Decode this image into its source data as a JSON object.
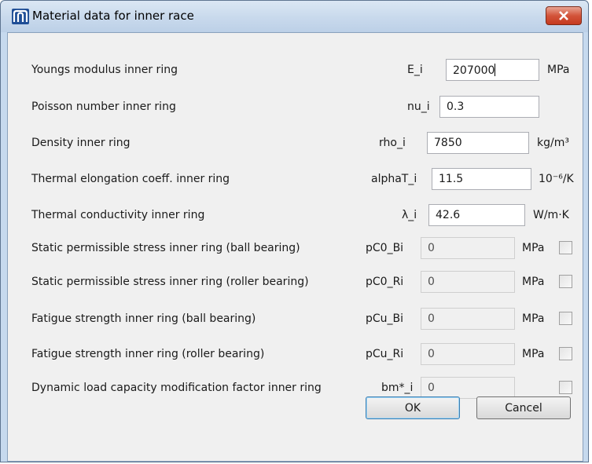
{
  "window": {
    "title": "Material data for inner race",
    "icon": "m-logo-icon"
  },
  "rows": [
    {
      "label": "Youngs modulus inner ring",
      "symbol": "E_i",
      "value": "207000",
      "unit": "MPa"
    },
    {
      "label": "Poisson number inner ring",
      "symbol": "nu_i",
      "value": "0.3",
      "unit": ""
    },
    {
      "label": "Density inner ring",
      "symbol": "rho_i",
      "value": "7850",
      "unit": "kg/m³"
    },
    {
      "label": "Thermal elongation coeff. inner ring",
      "symbol": "alphaT_i",
      "value": "11.5",
      "unit": "10⁻⁶/K"
    },
    {
      "label": "Thermal conductivity inner ring",
      "symbol": "λ_i",
      "value": "42.6",
      "unit": "W/m·K"
    },
    {
      "label": "Static permissible stress inner ring (ball bearing)",
      "symbol": "pC0_Bi",
      "value": "0",
      "unit": "MPa",
      "checked": false
    },
    {
      "label": "Static permissible stress inner ring (roller bearing)",
      "symbol": "pC0_Ri",
      "value": "0",
      "unit": "MPa",
      "checked": false
    },
    {
      "label": "Fatigue strength inner ring (ball bearing)",
      "symbol": "pCu_Bi",
      "value": "0",
      "unit": "MPa",
      "checked": false
    },
    {
      "label": "Fatigue strength inner ring (roller bearing)",
      "symbol": "pCu_Ri",
      "value": "0",
      "unit": "MPa",
      "checked": false
    },
    {
      "label": "Dynamic load capacity modification factor inner ring",
      "symbol": "bm*_i",
      "value": "0",
      "unit": "",
      "checked": false
    }
  ],
  "buttons": {
    "ok": "OK",
    "cancel": "Cancel"
  },
  "colors": {
    "close_button": "#c53a1f",
    "titlebar": "#c8d9ec",
    "client_bg": "#f0f0f0"
  }
}
